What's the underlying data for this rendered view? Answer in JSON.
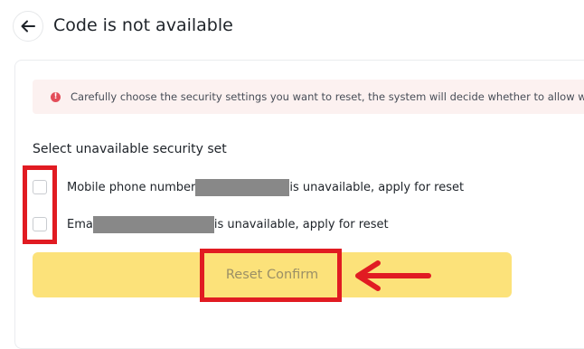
{
  "header": {
    "title": "Code is not available",
    "back_icon": "arrow-left-icon"
  },
  "alert": {
    "icon": "error-icon",
    "icon_color": "#e34d59",
    "text": "Carefully choose the security settings you want to reset, the system will decide whether to allow withdraw"
  },
  "security": {
    "label": "Select unavailable security set",
    "options": [
      {
        "prefix": "Mobile phone number",
        "suffix": "is unavailable, apply for reset",
        "checked": false
      },
      {
        "prefix": "Ema",
        "suffix": "is unavailable, apply for reset",
        "checked": false
      }
    ]
  },
  "actions": {
    "reset_label": "Reset Confirm",
    "reset_bg": "#fce27a"
  },
  "annotations": {
    "color": "#e11b22",
    "arrow_icon": "arrow-left-icon"
  }
}
